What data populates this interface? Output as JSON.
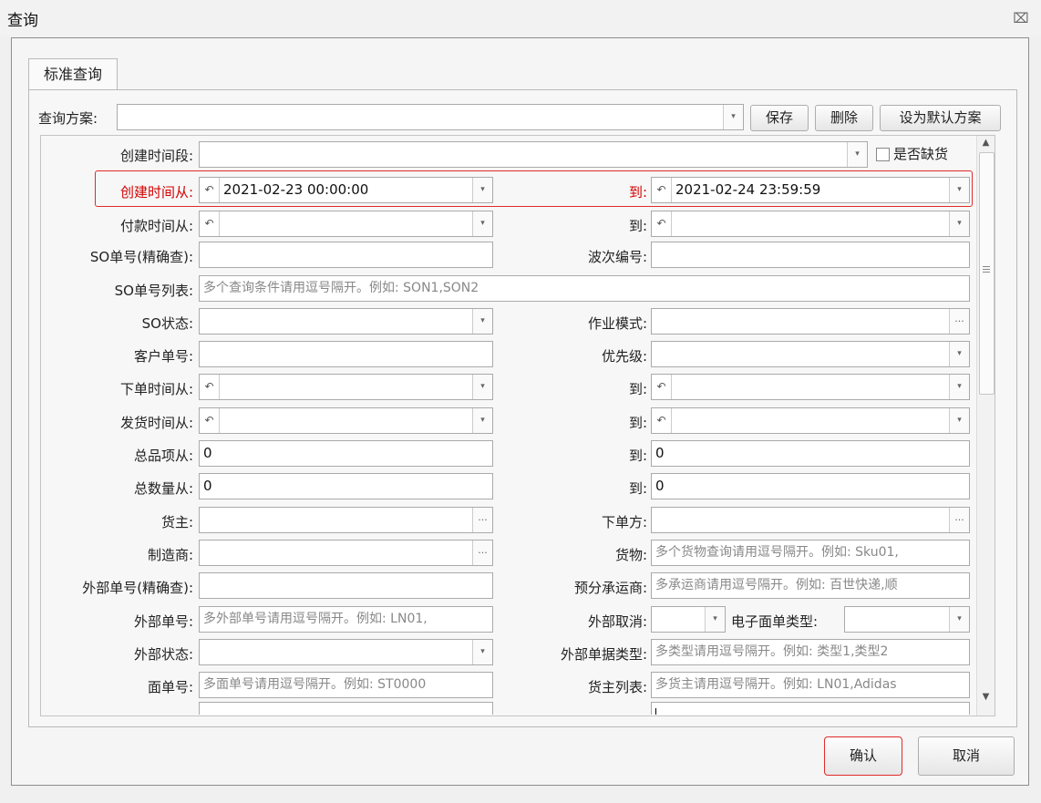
{
  "window": {
    "title": "查询",
    "close_icon": "⌧"
  },
  "tab": {
    "label": "标准查询"
  },
  "scheme": {
    "label": "查询方案:",
    "value": "",
    "save": "保存",
    "delete": "删除",
    "set_default": "设为默认方案"
  },
  "fields": {
    "create_period": {
      "label": "创建时间段:",
      "value": ""
    },
    "lack_goods": {
      "label": "是否缺货"
    },
    "create_from": {
      "label": "创建时间从:",
      "value": "2021-02-23 00:00:00"
    },
    "create_to": {
      "label": "到:",
      "value": "2021-02-24 23:59:59"
    },
    "pay_from": {
      "label": "付款时间从:",
      "value": ""
    },
    "pay_to": {
      "label": "到:",
      "value": ""
    },
    "so_exact": {
      "label": "SO单号(精确查):",
      "value": ""
    },
    "wave_no": {
      "label": "波次编号:",
      "value": ""
    },
    "so_list": {
      "label": "SO单号列表:",
      "placeholder": "多个查询条件请用逗号隔开。例如: SON1,SON2"
    },
    "so_status": {
      "label": "SO状态:",
      "value": ""
    },
    "work_mode": {
      "label": "作业模式:",
      "value": ""
    },
    "customer_no": {
      "label": "客户单号:",
      "value": ""
    },
    "priority": {
      "label": "优先级:",
      "value": ""
    },
    "order_from": {
      "label": "下单时间从:",
      "value": ""
    },
    "order_to": {
      "label": "到:",
      "value": ""
    },
    "ship_from": {
      "label": "发货时间从:",
      "value": ""
    },
    "ship_to": {
      "label": "到:",
      "value": ""
    },
    "items_from": {
      "label": "总品项从:",
      "value": "0"
    },
    "items_to": {
      "label": "到:",
      "value": "0"
    },
    "qty_from": {
      "label": "总数量从:",
      "value": "0"
    },
    "qty_to": {
      "label": "到:",
      "value": "0"
    },
    "owner": {
      "label": "货主:",
      "value": ""
    },
    "order_party": {
      "label": "下单方:",
      "value": ""
    },
    "manufacturer": {
      "label": "制造商:",
      "value": ""
    },
    "goods": {
      "label": "货物:",
      "placeholder": "多个货物查询请用逗号隔开。例如: Sku01,"
    },
    "ext_exact": {
      "label": "外部单号(精确查):",
      "value": ""
    },
    "carrier": {
      "label": "预分承运商:",
      "placeholder": "多承运商请用逗号隔开。例如: 百世快递,顺"
    },
    "ext_no": {
      "label": "外部单号:",
      "placeholder": "多外部单号请用逗号隔开。例如: LN01,"
    },
    "ext_cancel": {
      "label": "外部取消:",
      "value": ""
    },
    "eform_type": {
      "label": "电子面单类型:",
      "value": ""
    },
    "ext_status": {
      "label": "外部状态:",
      "value": ""
    },
    "ext_doc_type": {
      "label": "外部单据类型:",
      "placeholder": "多类型请用逗号隔开。例如: 类型1,类型2"
    },
    "face_no": {
      "label": "面单号:",
      "placeholder": "多面单号请用逗号隔开。例如: ST0000"
    },
    "owner_list": {
      "label": "货主列表:",
      "placeholder": "多货主请用逗号隔开。例如: LN01,Adidas"
    }
  },
  "buttons": {
    "confirm": "确认",
    "cancel": "取消"
  },
  "icons": {
    "undo": "↶",
    "dropdown": "▾",
    "ellipsis": "···"
  },
  "colors": {
    "highlight": "#e02b2b",
    "label_red": "#d40000"
  }
}
